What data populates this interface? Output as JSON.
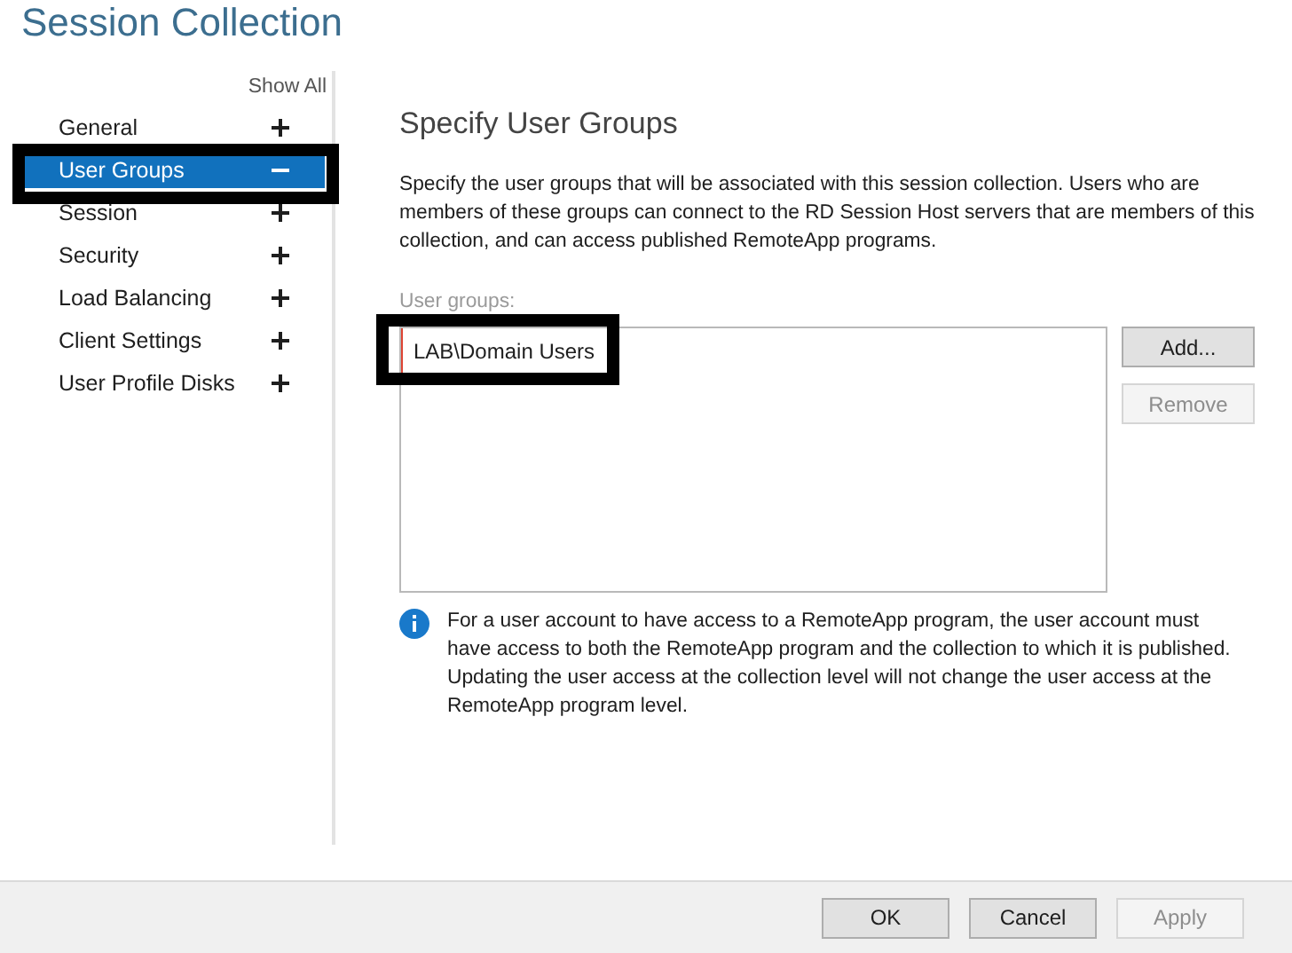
{
  "window": {
    "title": "Session Collection"
  },
  "sidebar": {
    "show_all": "Show All",
    "items": [
      {
        "label": "General",
        "expanded": false,
        "selected": false,
        "highlighted": false
      },
      {
        "label": "User Groups",
        "expanded": true,
        "selected": true,
        "highlighted": true
      },
      {
        "label": "Session",
        "expanded": false,
        "selected": false,
        "highlighted": false
      },
      {
        "label": "Security",
        "expanded": false,
        "selected": false,
        "highlighted": false
      },
      {
        "label": "Load Balancing",
        "expanded": false,
        "selected": false,
        "highlighted": false
      },
      {
        "label": "Client Settings",
        "expanded": false,
        "selected": false,
        "highlighted": false
      },
      {
        "label": "User Profile Disks",
        "expanded": false,
        "selected": false,
        "highlighted": false
      }
    ]
  },
  "page": {
    "heading": "Specify User Groups",
    "description": "Specify the user groups that will be associated with this session collection. Users who are members of these groups can connect to the RD Session Host servers that are members of this collection, and can access published RemoteApp programs.",
    "list_label": "User groups:",
    "user_groups": [
      {
        "name": "LAB\\Domain Users",
        "highlighted": true
      }
    ],
    "list_buttons": [
      {
        "label": "Add...",
        "disabled": false
      },
      {
        "label": "Remove",
        "disabled": true
      }
    ],
    "info": "For a user account to have access to a RemoteApp program, the user account must have access to both the RemoteApp program and the collection to which it is published. Updating the user access at the collection level will not change the user access at the RemoteApp program level."
  },
  "buttons": [
    {
      "label": "OK",
      "disabled": false
    },
    {
      "label": "Cancel",
      "disabled": false
    },
    {
      "label": "Apply",
      "disabled": true
    }
  ]
}
